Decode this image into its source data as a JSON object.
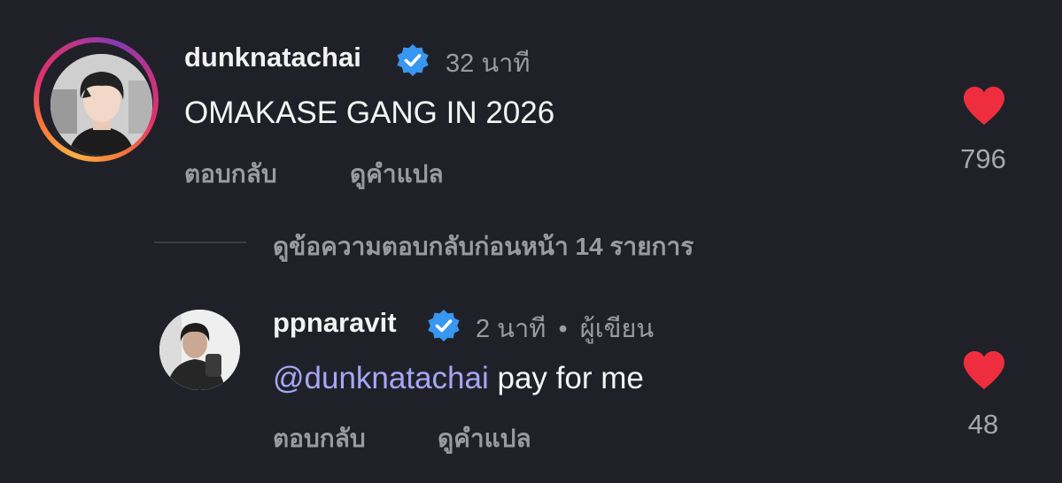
{
  "comment1": {
    "username": "dunknatachai",
    "time": "32 นาที",
    "text": "OMAKASE GANG IN 2026",
    "reply_label": "ตอบกลับ",
    "translate_label": "ดูคำแปล",
    "like_count": "796",
    "verified": true,
    "icons": {
      "verified": "verified-badge-icon",
      "like": "heart-icon"
    }
  },
  "view_previous_replies": "ดูข้อความตอบกลับก่อนหน้า 14 รายการ",
  "comment2": {
    "username": "ppnaravit",
    "time": "2 นาที",
    "separator": "•",
    "author_tag": "ผู้เขียน",
    "mention": "@dunknatachai",
    "text": " pay for me",
    "reply_label": "ตอบกลับ",
    "translate_label": "ดูคำแปล",
    "like_count": "48",
    "verified": true,
    "icons": {
      "verified": "verified-badge-icon",
      "like": "heart-icon"
    }
  },
  "colors": {
    "background": "#202128",
    "verified_blue": "#3897f0",
    "heart_red": "#ee2e3e",
    "mention": "#a6a6f6",
    "muted_text": "#9a9aa2"
  }
}
